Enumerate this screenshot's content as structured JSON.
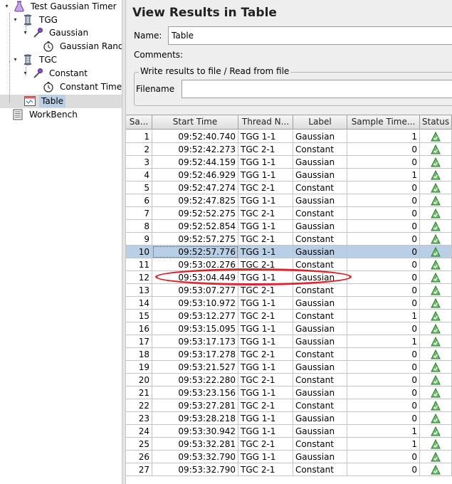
{
  "tree": {
    "items": [
      {
        "label": "Test Gaussian Timer",
        "icon": "flask-icon"
      },
      {
        "label": "TGG",
        "icon": "thread-group-icon"
      },
      {
        "label": "Gaussian",
        "icon": "sampler-icon"
      },
      {
        "label": "Gaussian Random Timer",
        "icon": "timer-icon"
      },
      {
        "label": "TGC",
        "icon": "thread-group-icon"
      },
      {
        "label": "Constant",
        "icon": "sampler-icon"
      },
      {
        "label": "Constant Timer",
        "icon": "timer-icon"
      },
      {
        "label": "Table",
        "icon": "table-listener-icon",
        "selected": true
      },
      {
        "label": "WorkBench",
        "icon": "workbench-icon"
      }
    ]
  },
  "panel": {
    "title": "View Results in Table",
    "name_label": "Name:",
    "name_value": "Table",
    "comments_label": "Comments:",
    "file_group_legend": "Write results to file / Read from file",
    "filename_label": "Filename"
  },
  "table": {
    "columns": [
      "Sa...",
      "Start Time",
      "Thread N...",
      "Label",
      "Sample Time...",
      "Status"
    ],
    "selected_row": 10,
    "highlighted_row": 12,
    "rows": [
      {
        "n": "1",
        "time": "09:52:40.740",
        "thread": "TGG 1-1",
        "label": "Gaussian",
        "sample": "1"
      },
      {
        "n": "2",
        "time": "09:52:42.273",
        "thread": "TGC 2-1",
        "label": "Constant",
        "sample": "0"
      },
      {
        "n": "3",
        "time": "09:52:44.159",
        "thread": "TGG 1-1",
        "label": "Gaussian",
        "sample": "0"
      },
      {
        "n": "4",
        "time": "09:52:46.929",
        "thread": "TGG 1-1",
        "label": "Gaussian",
        "sample": "1"
      },
      {
        "n": "5",
        "time": "09:52:47.274",
        "thread": "TGC 2-1",
        "label": "Constant",
        "sample": "0"
      },
      {
        "n": "6",
        "time": "09:52:47.825",
        "thread": "TGG 1-1",
        "label": "Gaussian",
        "sample": "0"
      },
      {
        "n": "7",
        "time": "09:52:52.275",
        "thread": "TGC 2-1",
        "label": "Constant",
        "sample": "0"
      },
      {
        "n": "8",
        "time": "09:52:52.854",
        "thread": "TGG 1-1",
        "label": "Gaussian",
        "sample": "0"
      },
      {
        "n": "9",
        "time": "09:52:57.275",
        "thread": "TGC 2-1",
        "label": "Constant",
        "sample": "0"
      },
      {
        "n": "10",
        "time": "09:52:57.776",
        "thread": "TGG 1-1",
        "label": "Gaussian",
        "sample": "0"
      },
      {
        "n": "11",
        "time": "09:53:02.276",
        "thread": "TGC 2-1",
        "label": "Constant",
        "sample": "0"
      },
      {
        "n": "12",
        "time": "09:53:04.449",
        "thread": "TGG 1-1",
        "label": "Gaussian",
        "sample": "0"
      },
      {
        "n": "13",
        "time": "09:53:07.277",
        "thread": "TGC 2-1",
        "label": "Constant",
        "sample": "0"
      },
      {
        "n": "14",
        "time": "09:53:10.972",
        "thread": "TGG 1-1",
        "label": "Gaussian",
        "sample": "0"
      },
      {
        "n": "15",
        "time": "09:53:12.277",
        "thread": "TGC 2-1",
        "label": "Constant",
        "sample": "1"
      },
      {
        "n": "16",
        "time": "09:53:15.095",
        "thread": "TGG 1-1",
        "label": "Gaussian",
        "sample": "0"
      },
      {
        "n": "17",
        "time": "09:53:17.173",
        "thread": "TGG 1-1",
        "label": "Gaussian",
        "sample": "1"
      },
      {
        "n": "18",
        "time": "09:53:17.278",
        "thread": "TGC 2-1",
        "label": "Constant",
        "sample": "0"
      },
      {
        "n": "19",
        "time": "09:53:21.527",
        "thread": "TGG 1-1",
        "label": "Gaussian",
        "sample": "0"
      },
      {
        "n": "20",
        "time": "09:53:22.280",
        "thread": "TGC 2-1",
        "label": "Constant",
        "sample": "0"
      },
      {
        "n": "21",
        "time": "09:53:23.156",
        "thread": "TGG 1-1",
        "label": "Gaussian",
        "sample": "0"
      },
      {
        "n": "22",
        "time": "09:53:27.281",
        "thread": "TGC 2-1",
        "label": "Constant",
        "sample": "0"
      },
      {
        "n": "23",
        "time": "09:53:28.218",
        "thread": "TGG 1-1",
        "label": "Gaussian",
        "sample": "0"
      },
      {
        "n": "24",
        "time": "09:53:30.942",
        "thread": "TGG 1-1",
        "label": "Gaussian",
        "sample": "1"
      },
      {
        "n": "25",
        "time": "09:53:32.281",
        "thread": "TGC 2-1",
        "label": "Constant",
        "sample": "1"
      },
      {
        "n": "26",
        "time": "09:53:32.790",
        "thread": "TGG 1-1",
        "label": "Gaussian",
        "sample": "0"
      },
      {
        "n": "27",
        "time": "09:53:32.790",
        "thread": "TGC 2-1",
        "label": "Constant",
        "sample": "0"
      }
    ],
    "status_icon": "success-triangle-icon"
  },
  "colors": {
    "selection": "#b8cfe5",
    "annotation": "#e0232a",
    "status_ok": "#3aa53a"
  }
}
